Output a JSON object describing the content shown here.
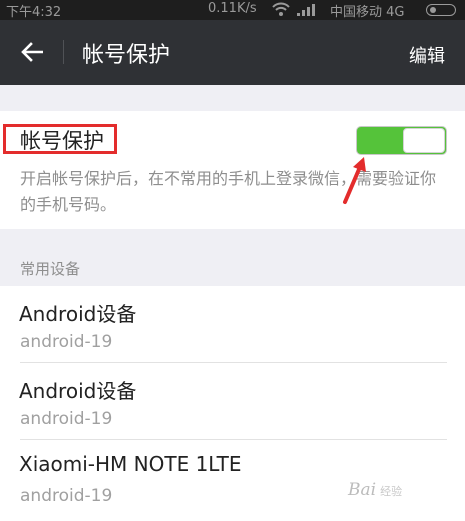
{
  "status_bar": {
    "time": "下午4:32",
    "network_speed": "0.11K/s",
    "carrier": "中国移动 4G",
    "icons": [
      "wifi-icon",
      "signal-icon",
      "battery-icon"
    ]
  },
  "app_bar": {
    "back_icon": "arrow-left-icon",
    "title": "帐号保护",
    "edit_label": "编辑"
  },
  "protection": {
    "title": "帐号保护",
    "description": "开启帐号保护后，在不常用的手机上登录微信，需要验证你的手机号码。",
    "toggle_on": true,
    "toggle_color": "#55c33a",
    "highlight_color": "#e32c2c"
  },
  "devices": {
    "header": "常用设备",
    "items": [
      {
        "name": "Android设备",
        "model": "android-19"
      },
      {
        "name": "Android设备",
        "model": "android-19"
      },
      {
        "name": "Xiaomi-HM NOTE 1LTE",
        "model": "android-19"
      }
    ]
  },
  "watermark": {
    "brand": "Bai",
    "sub": "经验"
  }
}
